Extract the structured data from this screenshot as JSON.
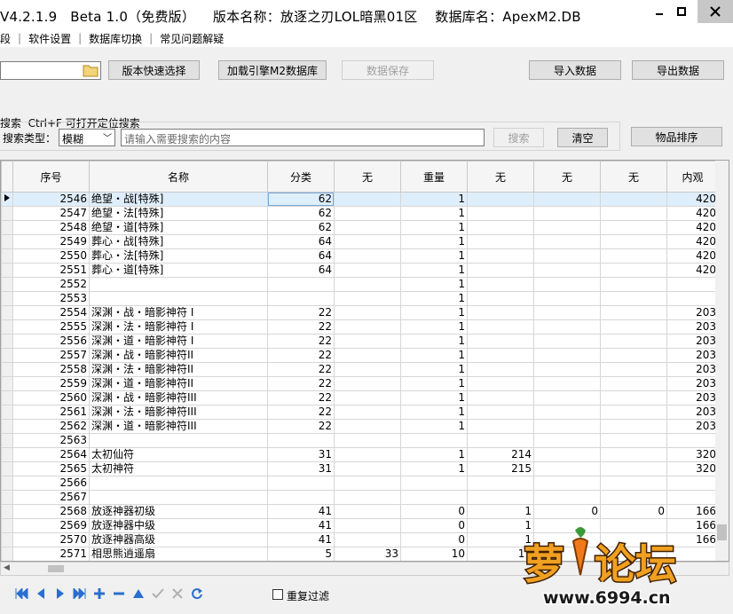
{
  "title": {
    "text": "V4.2.1.9   Beta 1.0（免费版）    版本名称：放逐之刃LOL暗黑01区    数据库名：ApexM2.DB"
  },
  "menu": [
    "段",
    "软件设置",
    "数据库切换",
    "常见问题解疑"
  ],
  "toolbar": {
    "quick_select": "版本快速选择",
    "load_engine": "加载引擎M2数据库",
    "save_data": "数据保存",
    "import_data": "导入数据",
    "export_data": "导出数据"
  },
  "search": {
    "header": "搜索  Ctrl+F 可打开定位搜索",
    "type_label": "搜索类型：",
    "type_value": "模糊",
    "placeholder": "请输入需要搜索的内容",
    "search_btn": "搜索",
    "clear_btn": "清空",
    "sort_btn": "物品排序"
  },
  "grid": {
    "columns": [
      "序号",
      "名称",
      "分类",
      "无",
      "重量",
      "无",
      "无",
      "无",
      "内观"
    ],
    "rows": [
      [
        "2546",
        "绝望・战[特殊]",
        "62",
        "",
        "1",
        "",
        "",
        "",
        "420"
      ],
      [
        "2547",
        "绝望・法[特殊]",
        "62",
        "",
        "1",
        "",
        "",
        "",
        "420"
      ],
      [
        "2548",
        "绝望・道[特殊]",
        "62",
        "",
        "1",
        "",
        "",
        "",
        "420"
      ],
      [
        "2549",
        "葬心・战[特殊]",
        "64",
        "",
        "1",
        "",
        "",
        "",
        "420"
      ],
      [
        "2550",
        "葬心・法[特殊]",
        "64",
        "",
        "1",
        "",
        "",
        "",
        "420"
      ],
      [
        "2551",
        "葬心・道[特殊]",
        "64",
        "",
        "1",
        "",
        "",
        "",
        "420"
      ],
      [
        "2552",
        "",
        "",
        "",
        "1",
        "",
        "",
        "",
        ""
      ],
      [
        "2553",
        "",
        "",
        "",
        "1",
        "",
        "",
        "",
        ""
      ],
      [
        "2554",
        "深渊・战・暗影神符 I",
        "22",
        "",
        "1",
        "",
        "",
        "",
        "203"
      ],
      [
        "2555",
        "深渊・法・暗影神符 I",
        "22",
        "",
        "1",
        "",
        "",
        "",
        "203"
      ],
      [
        "2556",
        "深渊・道・暗影神符 I",
        "22",
        "",
        "1",
        "",
        "",
        "",
        "203"
      ],
      [
        "2557",
        "深渊・战・暗影神符II",
        "22",
        "",
        "1",
        "",
        "",
        "",
        "203"
      ],
      [
        "2558",
        "深渊・法・暗影神符II",
        "22",
        "",
        "1",
        "",
        "",
        "",
        "203"
      ],
      [
        "2559",
        "深渊・道・暗影神符II",
        "22",
        "",
        "1",
        "",
        "",
        "",
        "203"
      ],
      [
        "2560",
        "深渊・战・暗影神符III",
        "22",
        "",
        "1",
        "",
        "",
        "",
        "203"
      ],
      [
        "2561",
        "深渊・法・暗影神符III",
        "22",
        "",
        "1",
        "",
        "",
        "",
        "203"
      ],
      [
        "2562",
        "深渊・道・暗影神符III",
        "22",
        "",
        "1",
        "",
        "",
        "",
        "203"
      ],
      [
        "2563",
        "",
        "",
        "",
        "",
        "",
        "",
        "",
        ""
      ],
      [
        "2564",
        "太初仙符",
        "31",
        "",
        "1",
        "214",
        "",
        "",
        "320"
      ],
      [
        "2565",
        "太初神符",
        "31",
        "",
        "1",
        "215",
        "",
        "",
        "320"
      ],
      [
        "2566",
        "",
        "",
        "",
        "",
        "",
        "",
        "",
        ""
      ],
      [
        "2567",
        "",
        "",
        "",
        "",
        "",
        "",
        "",
        ""
      ],
      [
        "2568",
        "放逐神器初级",
        "41",
        "",
        "0",
        "1",
        "0",
        "0",
        "166"
      ],
      [
        "2569",
        "放逐神器中级",
        "41",
        "",
        "0",
        "1",
        "",
        "",
        "166"
      ],
      [
        "2570",
        "放逐神器高级",
        "41",
        "",
        "0",
        "1",
        "",
        "",
        "166"
      ],
      [
        "2571",
        "相思熊逍遥扇",
        "5",
        "33",
        "10",
        "11",
        "",
        "",
        ""
      ]
    ]
  },
  "bottom": {
    "repeat_filter": "重复过滤"
  },
  "watermark": {
    "text": "萝卜论坛",
    "url": "www.6994.cn"
  },
  "colors": {
    "selected_row": "#dfeefb",
    "nav_icon": "#2a6fcf"
  }
}
